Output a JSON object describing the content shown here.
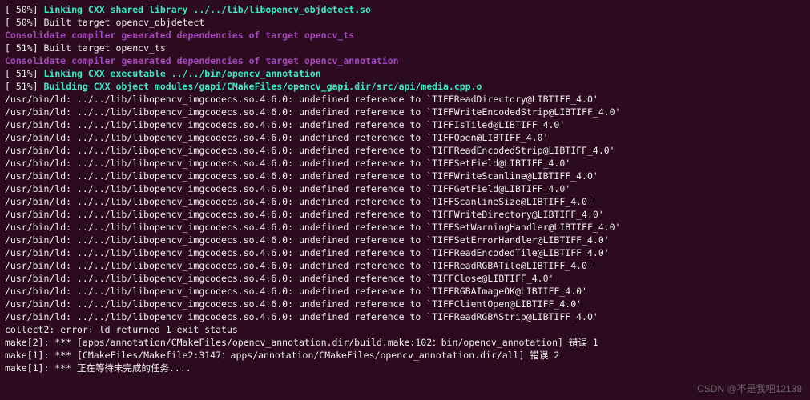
{
  "lines": [
    {
      "segs": [
        {
          "cls": "white",
          "t": "[ 50%] "
        },
        {
          "cls": "teal",
          "t": "Linking CXX shared library ../../lib/libopencv_objdetect.so"
        }
      ]
    },
    {
      "segs": [
        {
          "cls": "white",
          "t": "[ 50%] Built target opencv_objdetect"
        }
      ]
    },
    {
      "segs": [
        {
          "cls": "magenta",
          "t": "Consolidate compiler generated dependencies of target opencv_ts"
        }
      ]
    },
    {
      "segs": [
        {
          "cls": "white",
          "t": "[ 51%] Built target opencv_ts"
        }
      ]
    },
    {
      "segs": [
        {
          "cls": "magenta",
          "t": "Consolidate compiler generated dependencies of target opencv_annotation"
        }
      ]
    },
    {
      "segs": [
        {
          "cls": "white",
          "t": "[ 51%] "
        },
        {
          "cls": "teal",
          "t": "Linking CXX executable ../../bin/opencv_annotation"
        }
      ]
    },
    {
      "segs": [
        {
          "cls": "white",
          "t": "[ 51%] "
        },
        {
          "cls": "teal",
          "t": "Building CXX object modules/gapi/CMakeFiles/opencv_gapi.dir/src/api/media.cpp.o"
        }
      ]
    },
    {
      "segs": [
        {
          "cls": "white",
          "t": "/usr/bin/ld: ../../lib/libopencv_imgcodecs.so.4.6.0: undefined reference to `TIFFReadDirectory@LIBTIFF_4.0'"
        }
      ]
    },
    {
      "segs": [
        {
          "cls": "white",
          "t": "/usr/bin/ld: ../../lib/libopencv_imgcodecs.so.4.6.0: undefined reference to `TIFFWriteEncodedStrip@LIBTIFF_4.0'"
        }
      ]
    },
    {
      "segs": [
        {
          "cls": "white",
          "t": "/usr/bin/ld: ../../lib/libopencv_imgcodecs.so.4.6.0: undefined reference to `TIFFIsTiled@LIBTIFF_4.0'"
        }
      ]
    },
    {
      "segs": [
        {
          "cls": "white",
          "t": "/usr/bin/ld: ../../lib/libopencv_imgcodecs.so.4.6.0: undefined reference to `TIFFOpen@LIBTIFF_4.0'"
        }
      ]
    },
    {
      "segs": [
        {
          "cls": "white",
          "t": "/usr/bin/ld: ../../lib/libopencv_imgcodecs.so.4.6.0: undefined reference to `TIFFReadEncodedStrip@LIBTIFF_4.0'"
        }
      ]
    },
    {
      "segs": [
        {
          "cls": "white",
          "t": "/usr/bin/ld: ../../lib/libopencv_imgcodecs.so.4.6.0: undefined reference to `TIFFSetField@LIBTIFF_4.0'"
        }
      ]
    },
    {
      "segs": [
        {
          "cls": "white",
          "t": "/usr/bin/ld: ../../lib/libopencv_imgcodecs.so.4.6.0: undefined reference to `TIFFWriteScanline@LIBTIFF_4.0'"
        }
      ]
    },
    {
      "segs": [
        {
          "cls": "white",
          "t": "/usr/bin/ld: ../../lib/libopencv_imgcodecs.so.4.6.0: undefined reference to `TIFFGetField@LIBTIFF_4.0'"
        }
      ]
    },
    {
      "segs": [
        {
          "cls": "white",
          "t": "/usr/bin/ld: ../../lib/libopencv_imgcodecs.so.4.6.0: undefined reference to `TIFFScanlineSize@LIBTIFF_4.0'"
        }
      ]
    },
    {
      "segs": [
        {
          "cls": "white",
          "t": "/usr/bin/ld: ../../lib/libopencv_imgcodecs.so.4.6.0: undefined reference to `TIFFWriteDirectory@LIBTIFF_4.0'"
        }
      ]
    },
    {
      "segs": [
        {
          "cls": "white",
          "t": "/usr/bin/ld: ../../lib/libopencv_imgcodecs.so.4.6.0: undefined reference to `TIFFSetWarningHandler@LIBTIFF_4.0'"
        }
      ]
    },
    {
      "segs": [
        {
          "cls": "white",
          "t": "/usr/bin/ld: ../../lib/libopencv_imgcodecs.so.4.6.0: undefined reference to `TIFFSetErrorHandler@LIBTIFF_4.0'"
        }
      ]
    },
    {
      "segs": [
        {
          "cls": "white",
          "t": "/usr/bin/ld: ../../lib/libopencv_imgcodecs.so.4.6.0: undefined reference to `TIFFReadEncodedTile@LIBTIFF_4.0'"
        }
      ]
    },
    {
      "segs": [
        {
          "cls": "white",
          "t": "/usr/bin/ld: ../../lib/libopencv_imgcodecs.so.4.6.0: undefined reference to `TIFFReadRGBATile@LIBTIFF_4.0'"
        }
      ]
    },
    {
      "segs": [
        {
          "cls": "white",
          "t": "/usr/bin/ld: ../../lib/libopencv_imgcodecs.so.4.6.0: undefined reference to `TIFFClose@LIBTIFF_4.0'"
        }
      ]
    },
    {
      "segs": [
        {
          "cls": "white",
          "t": "/usr/bin/ld: ../../lib/libopencv_imgcodecs.so.4.6.0: undefined reference to `TIFFRGBAImageOK@LIBTIFF_4.0'"
        }
      ]
    },
    {
      "segs": [
        {
          "cls": "white",
          "t": "/usr/bin/ld: ../../lib/libopencv_imgcodecs.so.4.6.0: undefined reference to `TIFFClientOpen@LIBTIFF_4.0'"
        }
      ]
    },
    {
      "segs": [
        {
          "cls": "white",
          "t": "/usr/bin/ld: ../../lib/libopencv_imgcodecs.so.4.6.0: undefined reference to `TIFFReadRGBAStrip@LIBTIFF_4.0'"
        }
      ]
    },
    {
      "segs": [
        {
          "cls": "white",
          "t": "collect2: error: ld returned 1 exit status"
        }
      ]
    },
    {
      "segs": [
        {
          "cls": "white",
          "t": "make[2]: *** [apps/annotation/CMakeFiles/opencv_annotation.dir/build.make:102：bin/opencv_annotation] 错误 1"
        }
      ]
    },
    {
      "segs": [
        {
          "cls": "white",
          "t": "make[1]: *** [CMakeFiles/Makefile2:3147：apps/annotation/CMakeFiles/opencv_annotation.dir/all] 错误 2"
        }
      ]
    },
    {
      "segs": [
        {
          "cls": "white",
          "t": "make[1]: *** 正在等待未完成的任务...."
        }
      ]
    }
  ],
  "watermark": "CSDN @不是我吧12138"
}
